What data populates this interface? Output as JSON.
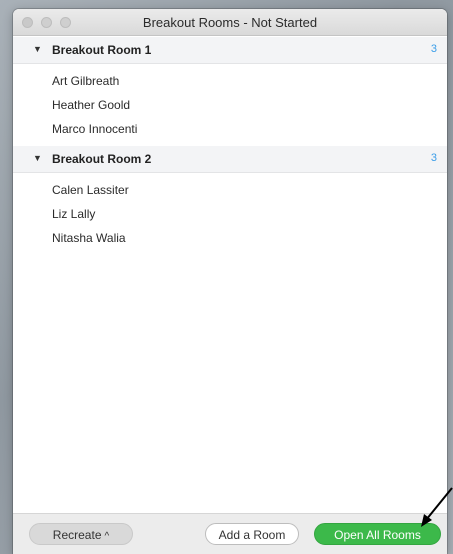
{
  "window": {
    "title": "Breakout Rooms - Not Started"
  },
  "rooms": [
    {
      "name": "Breakout Room 1",
      "count": "3",
      "participants": [
        "Art Gilbreath",
        "Heather Goold",
        "Marco Innocenti"
      ]
    },
    {
      "name": "Breakout Room 2",
      "count": "3",
      "participants": [
        "Calen Lassiter",
        "Liz Lally",
        "Nitasha Walia"
      ]
    }
  ],
  "footer": {
    "recreate_label": "Recreate",
    "add_room_label": "Add a Room",
    "open_all_label": "Open All Rooms"
  },
  "colors": {
    "accent_count": "#3a9de8",
    "open_button": "#3cb94a"
  }
}
